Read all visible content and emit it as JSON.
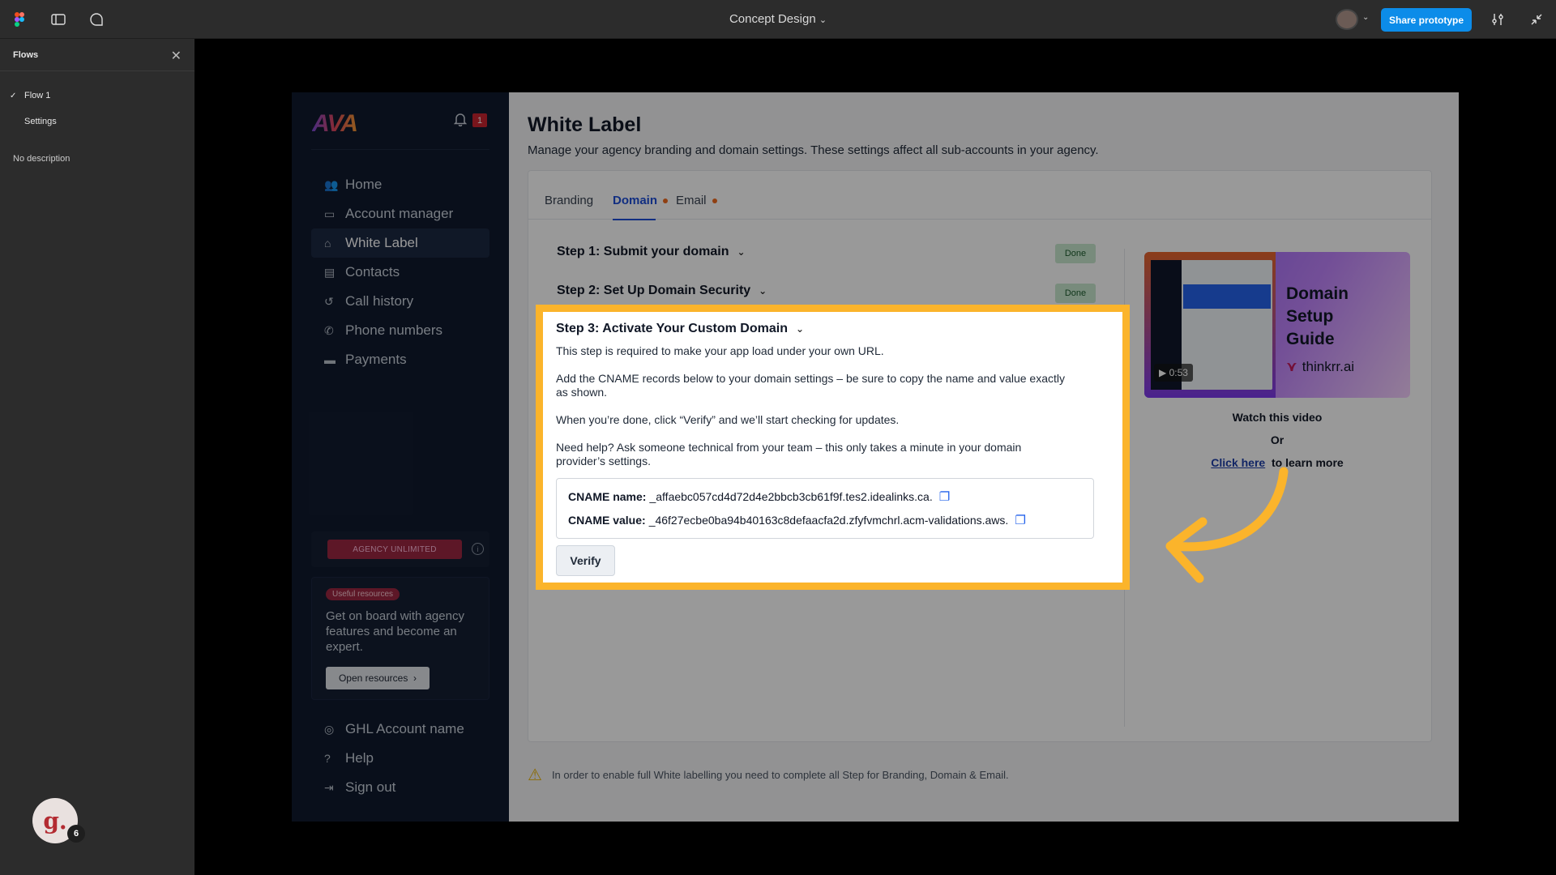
{
  "topbar": {
    "file_title": "Concept Design",
    "share_label": "Share prototype"
  },
  "flows": {
    "title": "Flows",
    "items": [
      "Flow 1",
      "Settings"
    ],
    "description": "No description",
    "avatar_letter": "g.",
    "avatar_count": "6"
  },
  "sidebar": {
    "logo": "AVA",
    "notif_count": "1",
    "nav": [
      {
        "label": "Home",
        "icon": "users-icon"
      },
      {
        "label": "Account manager",
        "icon": "folder-icon"
      },
      {
        "label": "White Label",
        "icon": "tag-icon"
      },
      {
        "label": "Contacts",
        "icon": "contacts-icon"
      },
      {
        "label": "Call history",
        "icon": "history-icon"
      },
      {
        "label": "Phone numbers",
        "icon": "phone-icon"
      },
      {
        "label": "Payments",
        "icon": "card-icon"
      }
    ],
    "plan_label": "AGENCY UNLIMITED",
    "resources": {
      "tag": "Useful resources",
      "text": "Get on board with agency features and become an expert.",
      "button": "Open resources"
    },
    "bottom_nav": [
      {
        "label": "GHL Account name",
        "icon": "account-icon"
      },
      {
        "label": "Help",
        "icon": "help-icon"
      },
      {
        "label": "Sign out",
        "icon": "signout-icon"
      }
    ]
  },
  "main": {
    "title": "White Label",
    "subtitle": "Manage your agency branding and domain settings. These settings affect all sub-accounts in your agency.",
    "tabs": [
      "Branding",
      "Domain",
      "Email"
    ],
    "step1": "Step 1: Submit your domain",
    "step2": "Step 2: Set Up Domain Security",
    "done_label": "Done",
    "step3": {
      "title": "Step 3: Activate Your Custom Domain",
      "p1": "This step is required to make your app load under your own URL.",
      "p2": "Add the CNAME records below to your domain settings – be sure to copy the name and value exactly as shown.",
      "p3": "When you’re done, click “Verify” and we’ll start checking for updates.",
      "p4": "Need help? Ask someone technical from your team – this only takes a minute in your domain provider’s settings.",
      "cname_name_label": "CNAME name:",
      "cname_name_value": "_affaebc057cd4d72d4e2bbcb3cb61f9f.tes2.idealinks.ca.",
      "cname_value_label": "CNAME value:",
      "cname_value_value": "_46f27ecbe0ba94b40163c8defaacfa2d.zfyfvmchrl.acm-validations.aws.",
      "verify_label": "Verify"
    },
    "video": {
      "title_line1": "Domain",
      "title_line2": "Setup",
      "title_line3": "Guide",
      "brand": "thinkrr.ai",
      "duration": "0:53",
      "caption1": "Watch this video",
      "caption2": "Or",
      "link": "Click here",
      "caption3": "to learn more"
    },
    "warning": "In order to enable full White labelling you need to complete all Step for Branding, Domain & Email."
  },
  "colors": {
    "accent": "#fbb42b",
    "primary": "#1d4ed8",
    "share": "#0c8ce9"
  }
}
